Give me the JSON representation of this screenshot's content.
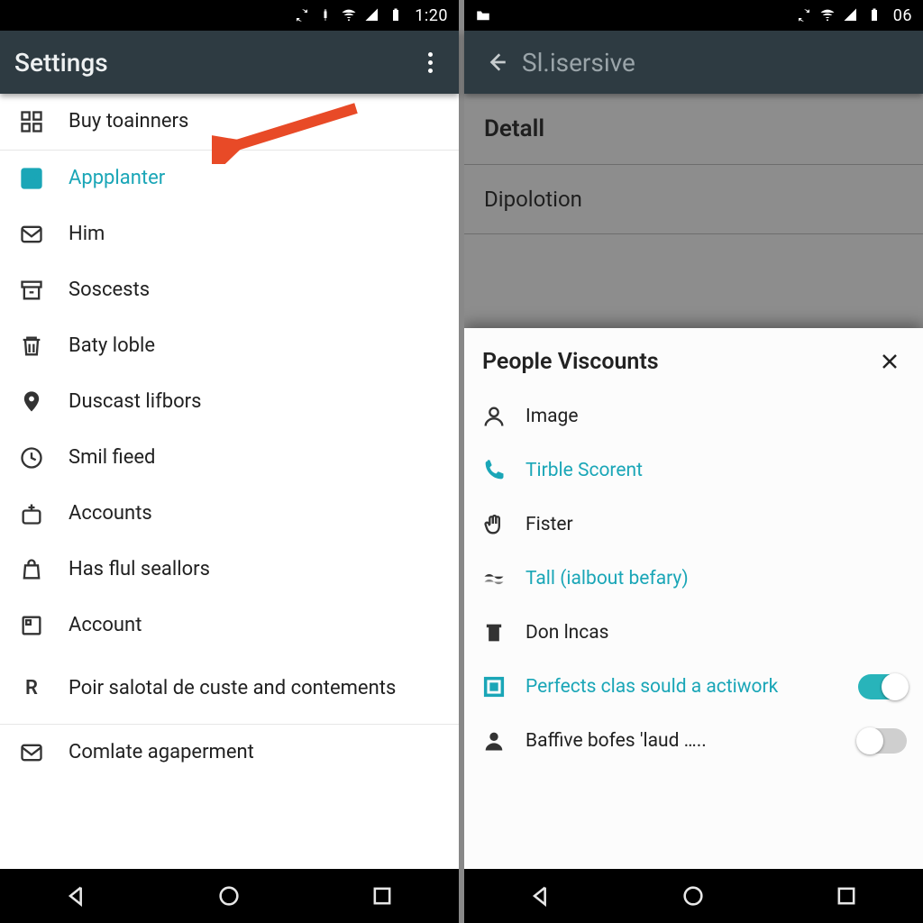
{
  "colors": {
    "accent": "#1aa6b7",
    "actionbar": "#2e3b42",
    "arrow": "#e84a27"
  },
  "left": {
    "status_time": "1:20",
    "title": "Settings",
    "items": [
      {
        "icon": "grid-icon",
        "label": "Buy toainners",
        "highlight": false
      },
      {
        "icon": "check-box-icon",
        "label": "Appplanter",
        "highlight": true
      },
      {
        "icon": "mail-x-icon",
        "label": "Him",
        "highlight": false
      },
      {
        "icon": "archive-icon",
        "label": "Soscests",
        "highlight": false
      },
      {
        "icon": "trash-icon",
        "label": "Baty loble",
        "highlight": false
      },
      {
        "icon": "pin-icon",
        "label": "Duscast lifbors",
        "highlight": false
      },
      {
        "icon": "clock-icon",
        "label": "Smil fieed",
        "highlight": false
      },
      {
        "icon": "plus-box-icon",
        "label": "Accounts",
        "highlight": false
      },
      {
        "icon": "bag-icon",
        "label": "Has flul seallors",
        "highlight": false
      },
      {
        "icon": "square-icon",
        "label": "Account",
        "highlight": false
      },
      {
        "icon": "letter-r-icon",
        "label": "Poir salotal de custe and contements",
        "highlight": false
      },
      {
        "icon": "envelope-icon",
        "label": "Comlate agaperment",
        "highlight": false
      }
    ]
  },
  "right": {
    "status_time": "06",
    "title": "Sl.isersive",
    "bg_header": "Detall",
    "bg_row": "Dipolotion",
    "sheet": {
      "title": "People Viscounts",
      "items": [
        {
          "icon": "person-icon",
          "label": "Image",
          "highlight": false,
          "toggle": null
        },
        {
          "icon": "phone-icon",
          "label": "Tirble Scorent",
          "highlight": true,
          "toggle": null
        },
        {
          "icon": "hand-icon",
          "label": "Fister",
          "highlight": false,
          "toggle": null
        },
        {
          "icon": "layers-icon",
          "label": "Tall (ialbout befary)",
          "highlight": true,
          "toggle": null
        },
        {
          "icon": "bin-icon",
          "label": "Don lncas",
          "highlight": false,
          "toggle": null
        },
        {
          "icon": "frame-icon",
          "label": "Perfects clas sould a actiwork",
          "highlight": true,
          "toggle": "on"
        },
        {
          "icon": "user-solid-icon",
          "label": "Baffive bofes 'laud …..",
          "highlight": false,
          "toggle": "off"
        }
      ]
    }
  }
}
